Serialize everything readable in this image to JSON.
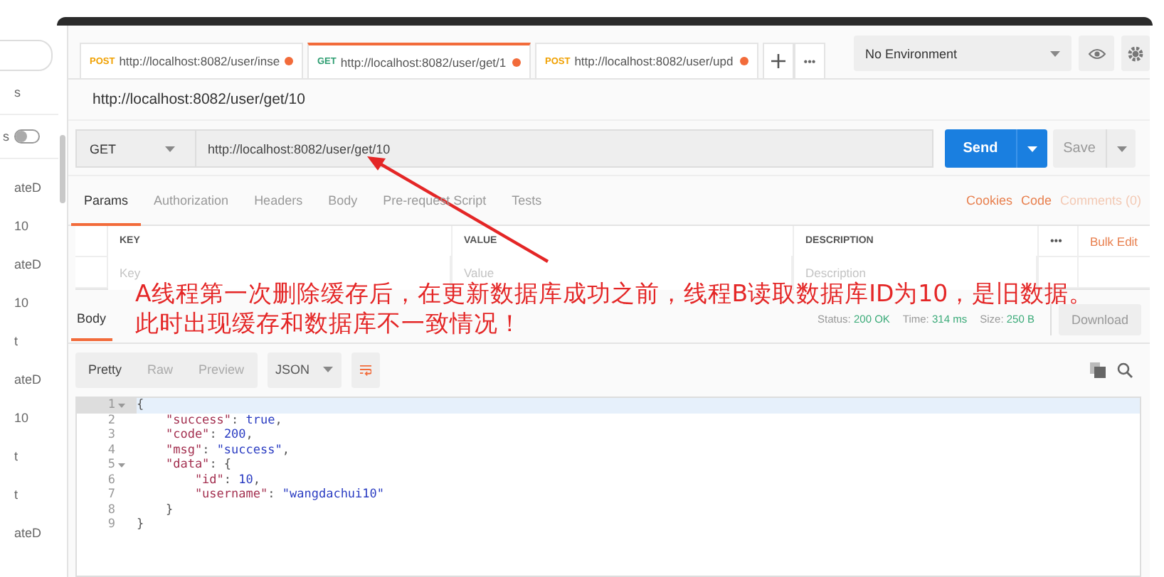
{
  "sidebar": {
    "items": [
      {
        "kind": "text",
        "text": "s"
      },
      {
        "kind": "toggle",
        "text": "s",
        "on": false
      },
      {
        "kind": "text",
        "text": "ateD"
      },
      {
        "kind": "text",
        "text": "10"
      },
      {
        "kind": "text",
        "text": "ateD"
      },
      {
        "kind": "text",
        "text": "10"
      },
      {
        "kind": "text",
        "text": "t"
      },
      {
        "kind": "text",
        "text": "ateD"
      },
      {
        "kind": "text",
        "text": "10"
      },
      {
        "kind": "text",
        "text": "t"
      },
      {
        "kind": "text",
        "text": "t"
      },
      {
        "kind": "text",
        "text": "ateD"
      }
    ]
  },
  "tabs": [
    {
      "method": "POST",
      "color": "#f0a000",
      "url": "http://localhost:8082/user/inse",
      "unsaved": true,
      "selected": false
    },
    {
      "method": "GET",
      "color": "#2f9e72",
      "url": "http://localhost:8082/user/get/1",
      "unsaved": true,
      "selected": true
    },
    {
      "method": "POST",
      "color": "#f0a000",
      "url": "http://localhost:8082/user/upd",
      "unsaved": true,
      "selected": false
    }
  ],
  "tab_more": "•••",
  "environment": "No Environment",
  "request": {
    "name": "http://localhost:8082/user/get/10",
    "method": "GET",
    "url": "http://localhost:8082/user/get/10",
    "send": "Send",
    "save": "Save"
  },
  "request_tabs": [
    {
      "label": "Params",
      "selected": true
    },
    {
      "label": "Authorization",
      "selected": false
    },
    {
      "label": "Headers",
      "selected": false
    },
    {
      "label": "Body",
      "selected": false
    },
    {
      "label": "Pre-request Script",
      "selected": false
    },
    {
      "label": "Tests",
      "selected": false
    }
  ],
  "request_links": [
    {
      "label": "Cookies",
      "disabled": false
    },
    {
      "label": "Code",
      "disabled": false
    },
    {
      "label": "Comments (0)",
      "disabled": true
    }
  ],
  "params_table": {
    "columns": [
      "KEY",
      "VALUE",
      "DESCRIPTION"
    ],
    "more": "•••",
    "bulk_edit": "Bulk Edit",
    "placeholders": [
      "Key",
      "Value",
      "Description"
    ]
  },
  "response": {
    "tabs": [
      {
        "label": "Body",
        "selected": true
      }
    ],
    "status": [
      {
        "label": "Status:",
        "value": "200 OK"
      },
      {
        "label": "Time:",
        "value": "314 ms"
      },
      {
        "label": "Size:",
        "value": "250 B"
      }
    ],
    "download": "Download",
    "views": [
      {
        "label": "Pretty",
        "selected": true
      },
      {
        "label": "Raw",
        "selected": false
      },
      {
        "label": "Preview",
        "selected": false
      }
    ],
    "format": "JSON",
    "lines": [
      {
        "number": "1",
        "fold": true,
        "active": true,
        "tokens": [
          {
            "kind": "punct",
            "text": "{"
          }
        ]
      },
      {
        "number": "2",
        "fold": false,
        "active": false,
        "tokens": [
          {
            "kind": "key",
            "text": "    \"success\""
          },
          {
            "kind": "punct",
            "text": ": "
          },
          {
            "kind": "literal",
            "text": "true"
          },
          {
            "kind": "punct",
            "text": ","
          }
        ]
      },
      {
        "number": "3",
        "fold": false,
        "active": false,
        "tokens": [
          {
            "kind": "key",
            "text": "    \"code\""
          },
          {
            "kind": "punct",
            "text": ": "
          },
          {
            "kind": "number",
            "text": "200"
          },
          {
            "kind": "punct",
            "text": ","
          }
        ]
      },
      {
        "number": "4",
        "fold": false,
        "active": false,
        "tokens": [
          {
            "kind": "key",
            "text": "    \"msg\""
          },
          {
            "kind": "punct",
            "text": ": "
          },
          {
            "kind": "string",
            "text": "\"success\""
          },
          {
            "kind": "punct",
            "text": ","
          }
        ]
      },
      {
        "number": "5",
        "fold": true,
        "active": false,
        "tokens": [
          {
            "kind": "key",
            "text": "    \"data\""
          },
          {
            "kind": "punct",
            "text": ": {"
          }
        ]
      },
      {
        "number": "6",
        "fold": false,
        "active": false,
        "tokens": [
          {
            "kind": "key",
            "text": "        \"id\""
          },
          {
            "kind": "punct",
            "text": ": "
          },
          {
            "kind": "number",
            "text": "10"
          },
          {
            "kind": "punct",
            "text": ","
          }
        ]
      },
      {
        "number": "7",
        "fold": false,
        "active": false,
        "tokens": [
          {
            "kind": "key",
            "text": "        \"username\""
          },
          {
            "kind": "punct",
            "text": ": "
          },
          {
            "kind": "string",
            "text": "\"wangdachui10\""
          }
        ]
      },
      {
        "number": "8",
        "fold": false,
        "active": false,
        "tokens": [
          {
            "kind": "punct",
            "text": "    }"
          }
        ]
      },
      {
        "number": "9",
        "fold": false,
        "active": false,
        "tokens": [
          {
            "kind": "punct",
            "text": "}"
          }
        ]
      }
    ]
  },
  "annotation": {
    "lines": [
      "A线程第一次删除缓存后，在更新数据库成功之前，线程B读取数据库ID为10，是旧数据。",
      "此时出现缓存和数据库不一致情况！"
    ]
  }
}
